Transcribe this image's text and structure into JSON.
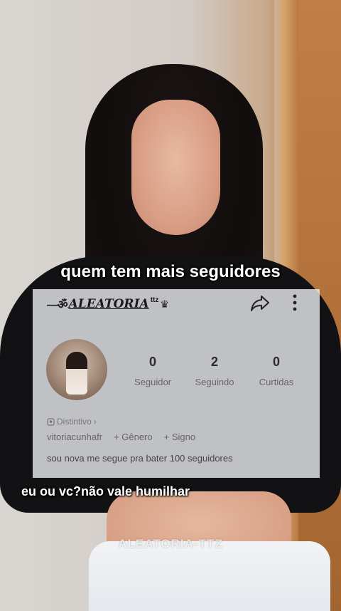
{
  "captions": {
    "top": "quem tem mais seguidores",
    "bottom": "eu ou vc?não vale humilhar"
  },
  "card": {
    "logo_text": "ALEATORIA",
    "logo_sup": "ttz",
    "stats": [
      {
        "value": "0",
        "label": "Seguidor"
      },
      {
        "value": "2",
        "label": "Seguindo"
      },
      {
        "value": "0",
        "label": "Curtidas"
      }
    ],
    "distintivo": "Distintivo",
    "username": "vitoriacunhafr",
    "genero": "+ Gênero",
    "signo": "+ Signo",
    "bio": "sou nova me segue pra bater 100 seguidores"
  },
  "watermark": "ALEATORIA-TTZ",
  "icons": [
    "share-icon",
    "more-vertical-icon",
    "badge-icon",
    "chevron-right-icon",
    "crown-icon"
  ]
}
